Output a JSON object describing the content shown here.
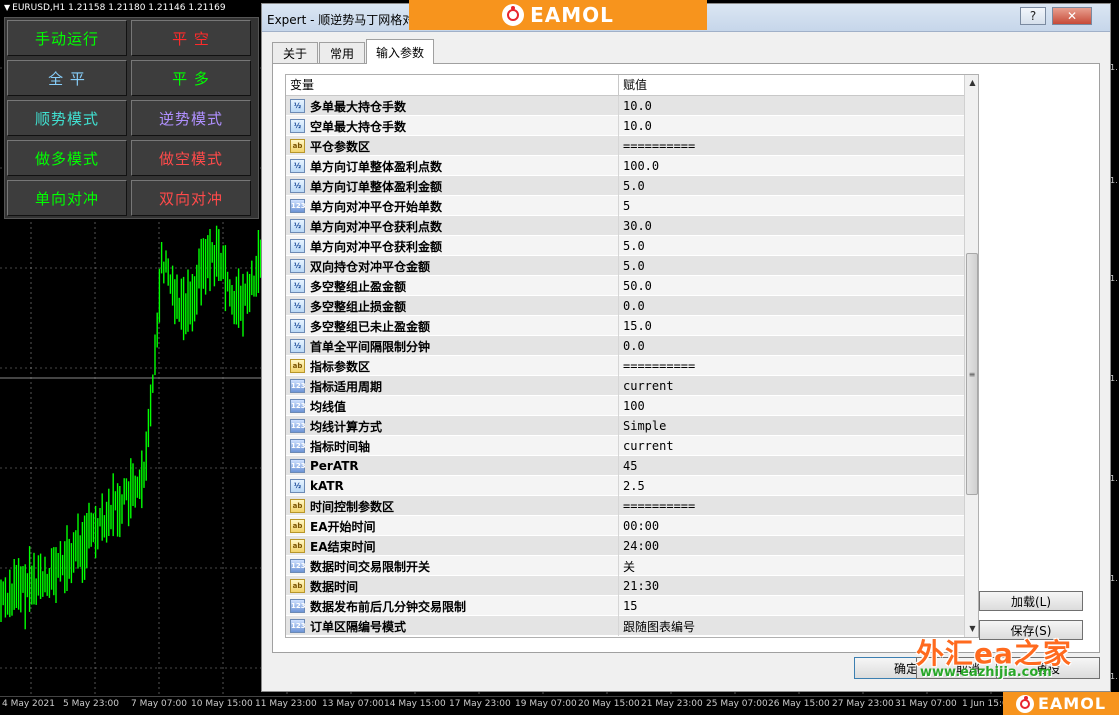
{
  "chart": {
    "symbol_text": "EURUSD,H1  1.21158 1.21180 1.21146 1.21169",
    "time_ticks": [
      "4 May 2021",
      "5 May 23:00",
      "7 May 07:00",
      "10 May 15:00",
      "11 May 23:00",
      "13 May 07:00",
      "14 May 15:00",
      "17 May 23:00",
      "19 May 07:00",
      "20 May 15:00",
      "21 May 23:00",
      "25 May 07:00",
      "26 May 15:00",
      "27 May 23:00",
      "31 May 07:00",
      "1 Jun 15:00"
    ],
    "price_ticks": [
      "1.",
      "1.",
      "1.",
      "1.",
      "1.",
      "1.",
      "1."
    ],
    "candle_color": "#00ff00",
    "grid_color": "#ffffff"
  },
  "control_panel": {
    "buttons": [
      {
        "label": "手动运行",
        "color": "#00ff00"
      },
      {
        "label": "平  空",
        "color": "#ff2a2a"
      },
      {
        "label": "全  平",
        "color": "#87cefa"
      },
      {
        "label": "平  多",
        "color": "#00ff00"
      },
      {
        "label": "顺势模式",
        "color": "#40e0d0"
      },
      {
        "label": "逆势模式",
        "color": "#b090ff"
      },
      {
        "label": "做多模式",
        "color": "#00ff00"
      },
      {
        "label": "做空模式",
        "color": "#ff4a4a"
      },
      {
        "label": "单向对冲",
        "color": "#00ff00"
      },
      {
        "label": "双向对冲",
        "color": "#ff4a4a"
      }
    ]
  },
  "brand": {
    "logo_text": "EAMOL",
    "accent": "#f7941d"
  },
  "dialog": {
    "title": "Expert - 顺逆势马丁网格对",
    "tabs": [
      "关于",
      "常用",
      "输入参数"
    ],
    "active_tab": "输入参数",
    "grid": {
      "col_variable": "变量",
      "col_value": "赋值",
      "rows": [
        {
          "icon": "num",
          "name": "多单最大持仓手数",
          "value": "10.0"
        },
        {
          "icon": "num",
          "name": "空单最大持仓手数",
          "value": "10.0"
        },
        {
          "icon": "str",
          "name": "平仓参数区",
          "value": "=========="
        },
        {
          "icon": "num",
          "name": "单方向订单整体盈利点数",
          "value": "100.0"
        },
        {
          "icon": "num",
          "name": "单方向订单整体盈利金额",
          "value": "5.0"
        },
        {
          "icon": "int",
          "name": "单方向对冲平仓开始单数",
          "value": "5"
        },
        {
          "icon": "num",
          "name": "单方向对冲平仓获利点数",
          "value": "30.0"
        },
        {
          "icon": "num",
          "name": "单方向对冲平仓获利金额",
          "value": "5.0"
        },
        {
          "icon": "num",
          "name": "双向持仓对冲平仓金额",
          "value": "5.0"
        },
        {
          "icon": "num",
          "name": "多空整组止盈金额",
          "value": "50.0"
        },
        {
          "icon": "num",
          "name": "多空整组止损金额",
          "value": "0.0"
        },
        {
          "icon": "num",
          "name": "多空整组已未止盈金额",
          "value": "15.0"
        },
        {
          "icon": "num",
          "name": "首单全平间隔限制分钟",
          "value": "0.0"
        },
        {
          "icon": "str",
          "name": "指标参数区",
          "value": "=========="
        },
        {
          "icon": "int",
          "name": "指标适用周期",
          "value": "current"
        },
        {
          "icon": "int",
          "name": "均线值",
          "value": "100"
        },
        {
          "icon": "int",
          "name": "均线计算方式",
          "value": "Simple"
        },
        {
          "icon": "int",
          "name": "指标时间轴",
          "value": "current"
        },
        {
          "icon": "int",
          "name": "PerATR",
          "value": "45"
        },
        {
          "icon": "num",
          "name": "kATR",
          "value": "2.5"
        },
        {
          "icon": "str",
          "name": "时间控制参数区",
          "value": "=========="
        },
        {
          "icon": "str",
          "name": "EA开始时间",
          "value": "00:00"
        },
        {
          "icon": "str",
          "name": "EA结束时间",
          "value": "24:00"
        },
        {
          "icon": "int",
          "name": "数据时间交易限制开关",
          "value": "关"
        },
        {
          "icon": "str",
          "name": "数据时间",
          "value": "21:30"
        },
        {
          "icon": "int",
          "name": "数据发布前后几分钟交易限制",
          "value": "15"
        },
        {
          "icon": "int",
          "name": "订单区隔编号模式",
          "value": "跟随图表编号"
        }
      ]
    },
    "load_button": "加载(L)",
    "save_button": "保存(S)",
    "ok_button": "确定",
    "cancel_button": "取消",
    "reset_button": "重设"
  },
  "watermark": {
    "main": "外汇ea之家",
    "url": "www.eazhijia.com"
  }
}
